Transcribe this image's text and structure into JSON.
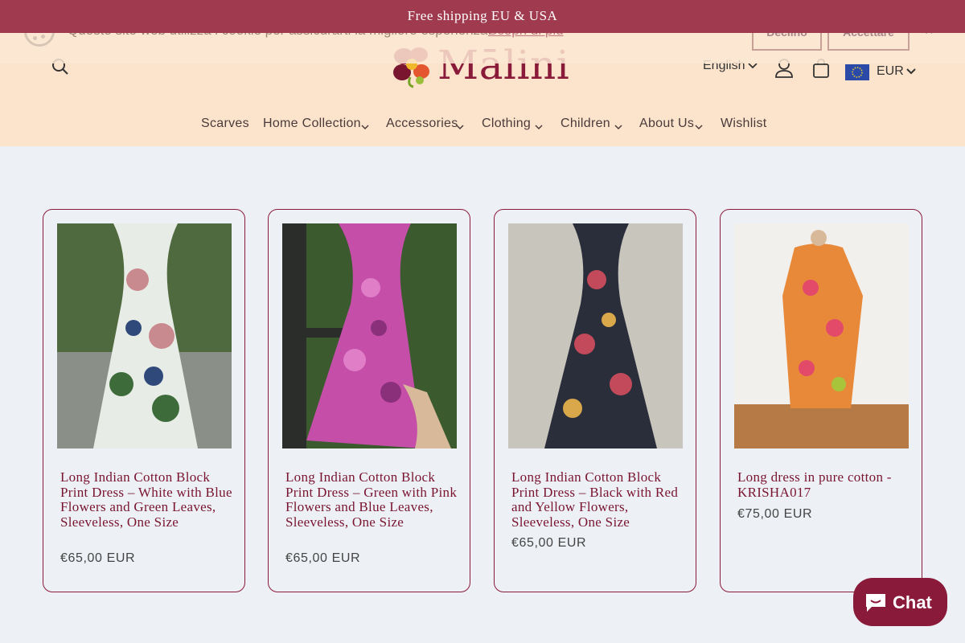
{
  "announcement": "Free shipping EU & USA",
  "cookie": {
    "message": "Questo sito web utilizza i cookie per assicurarti la migliore esperienza.",
    "learn_more": "Scopri di più",
    "decline": "Declino",
    "accept": "Accettare",
    "close": "×"
  },
  "header": {
    "logo": "Mālini",
    "language": "English",
    "currency": "EUR"
  },
  "nav": [
    {
      "label": "Scarves"
    },
    {
      "label": "Home Collection"
    },
    {
      "label": "Accessories"
    },
    {
      "label": "Clothing"
    },
    {
      "label": "Children"
    },
    {
      "label": "About Us"
    },
    {
      "label": "Wishlist"
    }
  ],
  "products": [
    {
      "title": "Long Indian Cotton Block Print Dress – White with Blue Flowers and Green Leaves, Sleeveless, One Size",
      "price": "€65,00 EUR"
    },
    {
      "title": "Long Indian Cotton Block Print Dress – Green with Pink Flowers and Blue Leaves, Sleeveless, One Size",
      "price": "€65,00 EUR"
    },
    {
      "title": "Long Indian Cotton Block Print Dress – Black with Red and Yellow Flowers, Sleeveless, One Size",
      "price": "€65,00 EUR"
    },
    {
      "title": "Long dress in pure cotton - KRISHA017",
      "price": "€75,00 EUR"
    }
  ],
  "chat": {
    "label": "Chat"
  },
  "colors": {
    "accent": "#8a1a3a",
    "announcement_bg": "#a03a4f",
    "header_bg": "#fce4cc",
    "page_bg": "#edf0f5"
  }
}
